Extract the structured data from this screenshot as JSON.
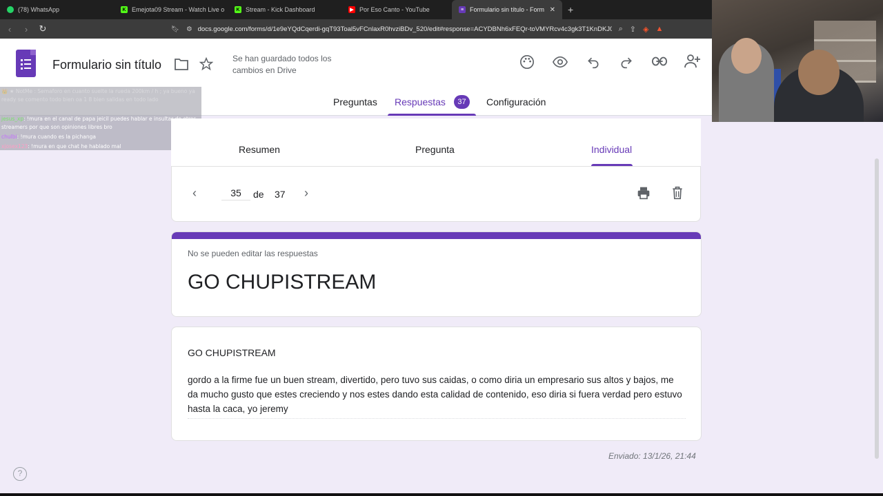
{
  "browser": {
    "tabs": [
      {
        "label": "(78) WhatsApp",
        "icon": "whatsapp-icon",
        "color": "#25d366"
      },
      {
        "label": "Emejota09 Stream - Watch Live o",
        "icon": "kick-icon",
        "color": "#53fc18"
      },
      {
        "label": "Stream - Kick Dashboard",
        "icon": "kick-icon",
        "color": "#53fc18"
      },
      {
        "label": "Por Eso Canto - YouTube",
        "icon": "youtube-icon",
        "color": "#ff0000"
      },
      {
        "label": "Formulario sin título - Formular",
        "icon": "forms-icon",
        "color": "#673ab7"
      }
    ],
    "url": "docs.google.com/forms/d/1e9eYQdCqerdi-gqT93Toal5vFCnlaxR0hvziBDv_520/edit#response=ACYDBNh6xFEQr-toVMYRcv4c3gk3T1KnDKJ082y..."
  },
  "chat": {
    "faded_line": "👑 ★ NotMe : Semaforo en cuanto suelte la rueda 200km / h ; ya bueno ya ready se comento todo bien oa 1 8 bien salidas en todo lado",
    "messages": [
      {
        "user": "jesus_xp",
        "text": ": !mura en el canal de papa jeicil puedes hablar e insultar de otros streamers por que son opiniones libres bro"
      },
      {
        "user": "chulbi",
        "text": ": !mura cuando es la pichanga"
      },
      {
        "user": "xjosex123",
        "text": ": !mura en que chat he hablado mal"
      }
    ]
  },
  "header": {
    "form_title": "Formulario sin título",
    "saved_status": "Se han guardado todos los cambios en Drive",
    "tabs": {
      "questions": "Preguntas",
      "responses": "Respuestas",
      "settings": "Configuración"
    },
    "responses_count": "37"
  },
  "subtabs": {
    "summary": "Resumen",
    "question": "Pregunta",
    "individual": "Individual"
  },
  "navigation": {
    "current": "35",
    "of_label": "de",
    "total": "37"
  },
  "response": {
    "notice": "No se pueden editar las respuestas",
    "form_title": "GO CHUPISTREAM",
    "question_title": "GO CHUPISTREAM",
    "answer": "gordo a la firme fue un buen stream, divertido, pero tuvo sus caidas, o como diria un empresario sus altos y bajos, me da mucho gusto que estes creciendo y nos estes dando esta calidad de contenido, eso diria si fuera verdad pero estuvo hasta la caca, yo jeremy",
    "submitted": "Enviado: 13/1/26, 21:44"
  },
  "colors": {
    "accent": "#673ab7",
    "background": "#f0ebf8"
  }
}
